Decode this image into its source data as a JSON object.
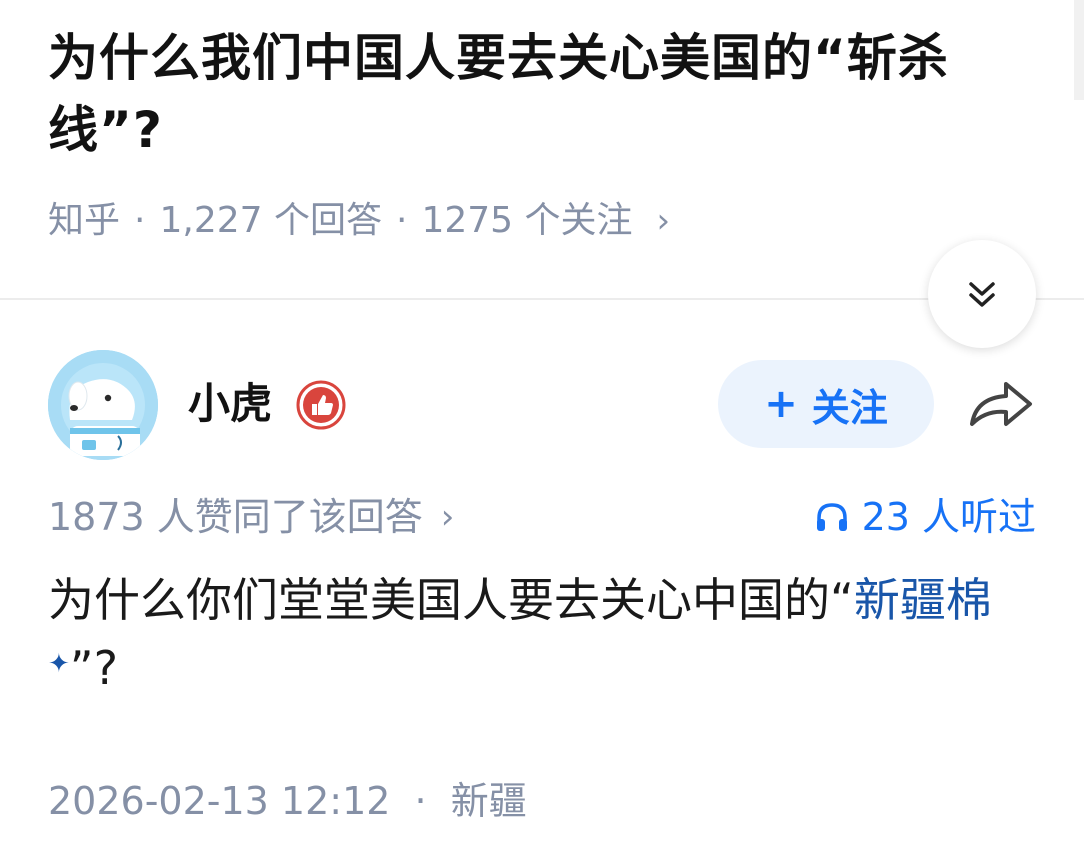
{
  "question": {
    "title": "为什么我们中国人要去关心美国的“斩杀线”?",
    "source": "知乎",
    "sep": "·",
    "answer_count": "1,227 个回答",
    "follow_count": "1275 个关注",
    "chevron": "›"
  },
  "author": {
    "name": "小虎",
    "follow_plus": "+",
    "follow_label": "关注"
  },
  "answer": {
    "upvotes": "1873 人赞同了该回答",
    "chevron": "›",
    "listened": "23 人听过",
    "body_before": "为什么你们堂堂美国人要去关心中国的“",
    "body_link": "新疆棉",
    "body_spark": "✦",
    "body_after": "”?",
    "date": "2026-02-13 12:12",
    "dot": "·",
    "location": "新疆"
  },
  "icons": {
    "collapse": "double-chevron-down-icon",
    "share": "share-arrow-icon",
    "headphones": "headphones-icon",
    "badge": "thumbs-up-badge-icon"
  },
  "colors": {
    "accent": "#1772f6",
    "link": "#1956a9",
    "meta": "#8590a6",
    "follow_bg": "#ebf3fd",
    "badge": "#d9453d"
  }
}
